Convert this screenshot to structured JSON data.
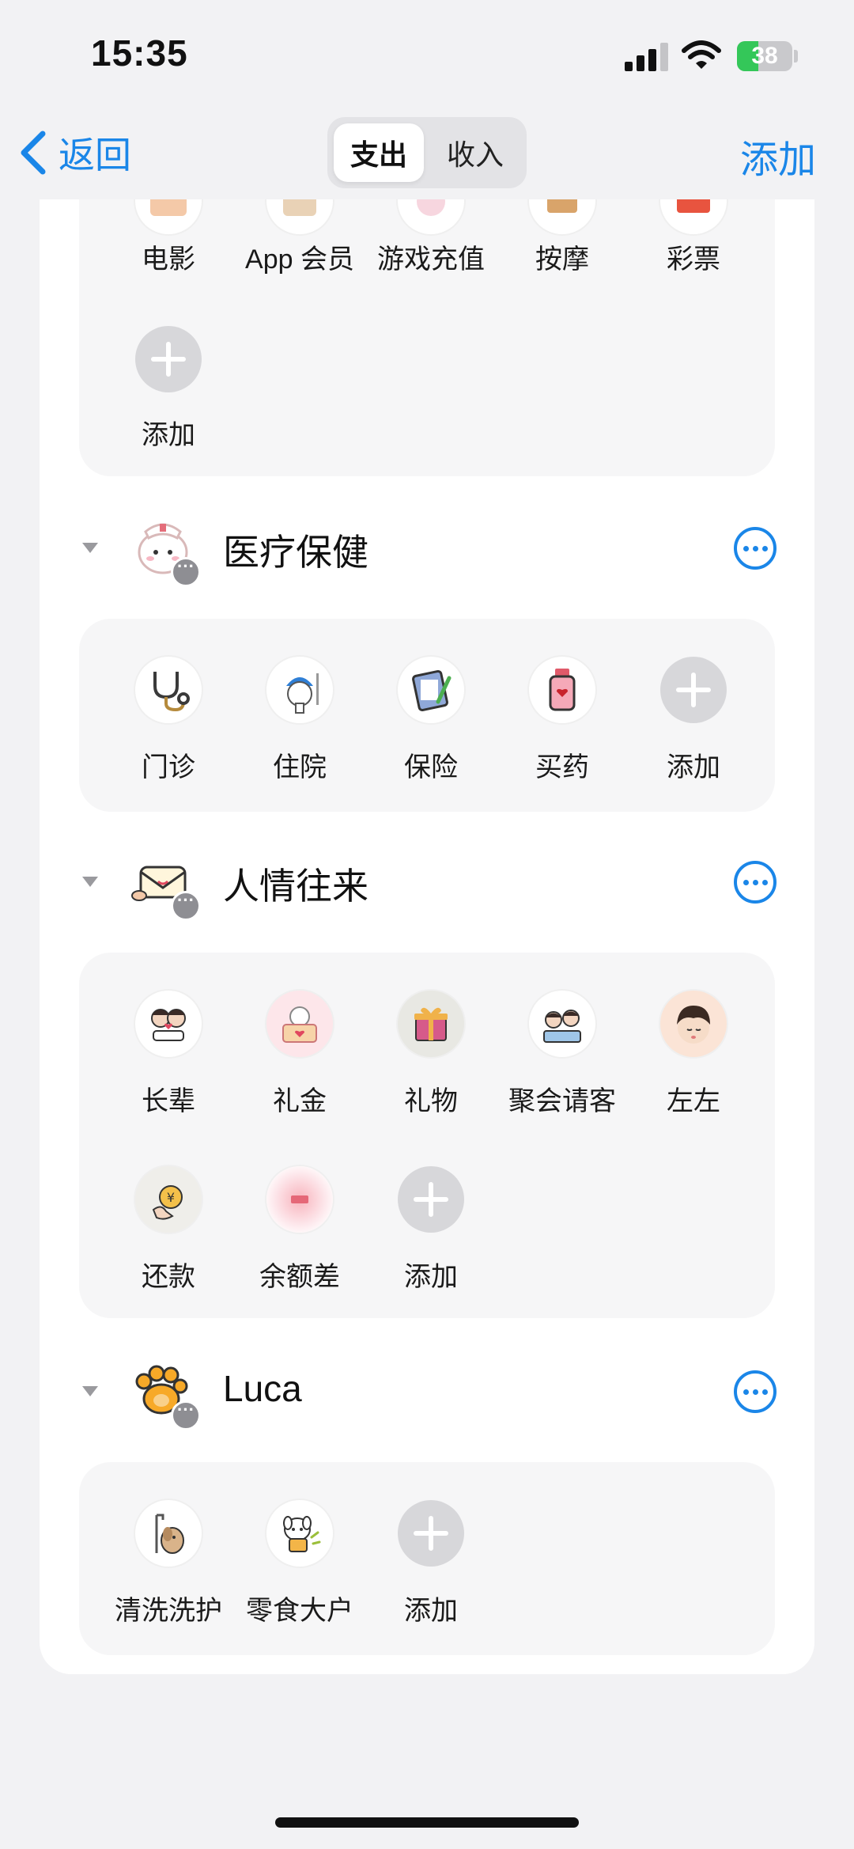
{
  "status_bar": {
    "time": "15:35",
    "battery_level": "38",
    "battery_fraction": 0.38
  },
  "nav": {
    "back_label": "返回",
    "segments": [
      "支出",
      "收入"
    ],
    "active_segment": "支出",
    "add_label": "添加"
  },
  "top_group": {
    "items": [
      "电影",
      "App 会员",
      "游戏充值",
      "按摩",
      "彩票"
    ],
    "add_label": "添加"
  },
  "sections": [
    {
      "title": "医疗保健",
      "items": [
        "门诊",
        "住院",
        "保险",
        "买药"
      ],
      "add_label": "添加"
    },
    {
      "title": "人情往来",
      "items": [
        "长辈",
        "礼金",
        "礼物",
        "聚会请客",
        "左左",
        "还款",
        "余额差"
      ],
      "add_label": "添加"
    },
    {
      "title": "Luca",
      "items": [
        "清洗洗护",
        "零食大户"
      ],
      "add_label": "添加"
    }
  ],
  "colors": {
    "accent": "#1a86e8",
    "background": "#f2f2f4",
    "card": "#f6f6f7"
  }
}
